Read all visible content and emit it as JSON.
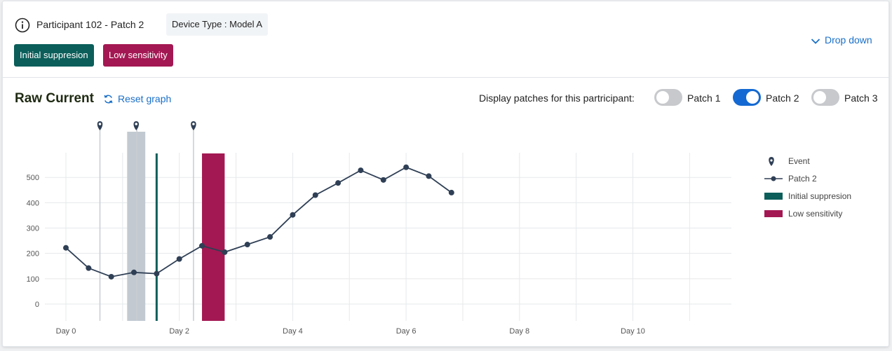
{
  "header": {
    "participant": "Participant 102 - Patch 2",
    "device_type": "Device Type : Model A",
    "tags": [
      "Initial suppresion",
      "Low sensitivity"
    ],
    "dropdown_label": "Drop down"
  },
  "graph": {
    "title": "Raw Current",
    "reset_label": "Reset graph",
    "patches_label": "Display patches for this partricipant:",
    "patches": [
      {
        "label": "Patch 1",
        "on": false
      },
      {
        "label": "Patch 2",
        "on": true
      },
      {
        "label": "Patch 3",
        "on": false
      }
    ]
  },
  "colors": {
    "accent": "#1a6fc9",
    "series": "#2f3f55",
    "initial_suppression": "#0b5e5a",
    "low_sensitivity": "#a31852",
    "event_band": "#c2c9d1"
  },
  "chart_data": {
    "type": "line",
    "x_ticks": [
      "Day 0",
      "Day 2",
      "Day 4",
      "Day 6",
      "Day 8",
      "Day 10"
    ],
    "xlim": [
      0,
      11.5
    ],
    "ylim": [
      -60,
      600
    ],
    "y_ticks": [
      0,
      100,
      200,
      300,
      400,
      500
    ],
    "grid": true,
    "legend_position": "right",
    "legend": [
      "Event",
      "Patch 2",
      "Initial suppresion",
      "Low sensitivity"
    ],
    "series": [
      {
        "name": "Patch 2",
        "x": [
          0,
          0.4,
          0.8,
          1.2,
          1.6,
          2.0,
          2.4,
          2.8,
          3.2,
          3.6,
          4.0,
          4.4,
          4.8,
          5.2,
          5.6,
          6.0,
          6.4,
          6.8
        ],
        "y": [
          222,
          142,
          108,
          125,
          120,
          178,
          230,
          205,
          235,
          265,
          352,
          430,
          478,
          528,
          490,
          540,
          505,
          440
        ]
      }
    ],
    "events": [
      0.6,
      1.25,
      2.25
    ],
    "event_band": [
      1.08,
      1.4
    ],
    "initial_suppression": 1.6,
    "low_sensitivity": [
      2.4,
      2.8
    ]
  }
}
